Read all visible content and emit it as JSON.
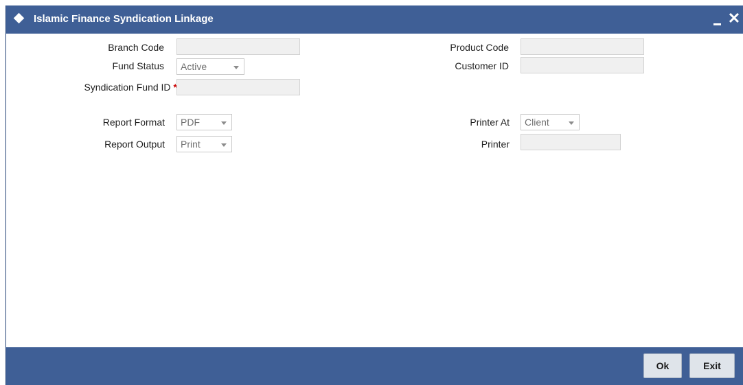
{
  "window": {
    "title": "Islamic Finance Syndication Linkage",
    "close_glyph": "✕"
  },
  "form": {
    "branch_code_label": "Branch Code",
    "branch_code_value": "",
    "product_code_label": "Product Code",
    "product_code_value": "",
    "fund_status_label": "Fund Status",
    "fund_status_value": "Active",
    "customer_id_label": "Customer ID",
    "customer_id_value": "",
    "syndication_fund_id_label": "Syndication Fund ID",
    "required_marker": "*",
    "syndication_fund_id_value": "",
    "report_format_label": "Report Format",
    "report_format_value": "PDF",
    "printer_at_label": "Printer At",
    "printer_at_value": "Client",
    "report_output_label": "Report Output",
    "report_output_value": "Print",
    "printer_label": "Printer",
    "printer_value": ""
  },
  "footer": {
    "ok_label": "Ok",
    "exit_label": "Exit"
  },
  "colors": {
    "titlebar": "#3f5f96",
    "required": "#cc0000"
  }
}
